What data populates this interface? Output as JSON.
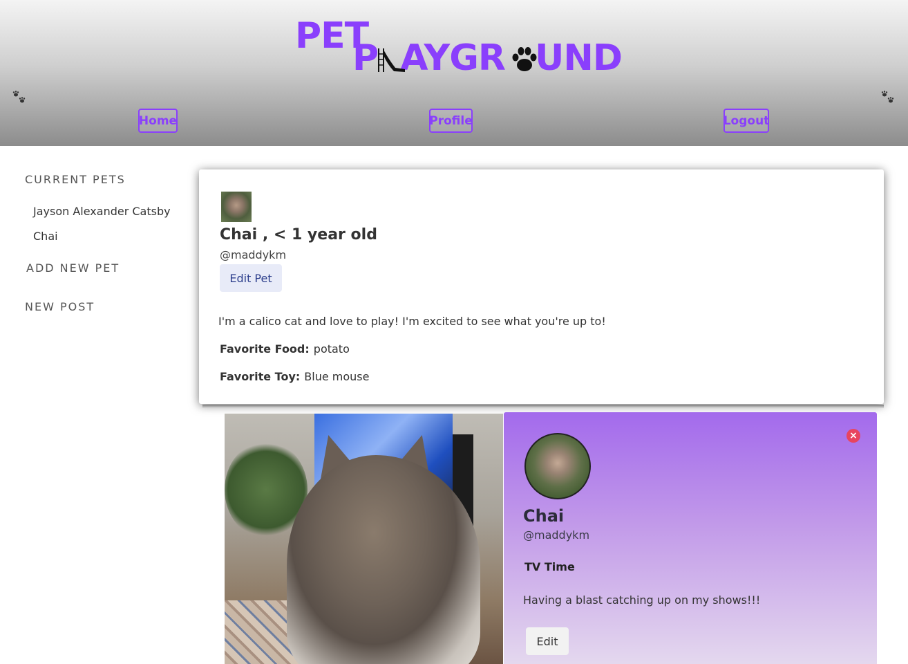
{
  "header": {
    "logo_pet": "PET",
    "logo_play_prefix": "P",
    "logo_play_mid": "AYGR",
    "logo_play_suffix": "UND",
    "brand_color": "#8a3ffc",
    "nav": {
      "home": "Home",
      "profile": "Profile",
      "logout": "Logout"
    }
  },
  "sidebar": {
    "current_pets_heading": "CURRENT PETS",
    "pets": [
      "Jayson Alexander Catsby",
      "Chai"
    ],
    "add_new_pet": "ADD NEW PET",
    "new_post": "NEW POST"
  },
  "profile": {
    "title": "Chai , < 1 year old",
    "handle": "@maddykm",
    "edit_button": "Edit Pet",
    "bio": "I'm a calico cat and love to play! I'm excited to see what you're up to!",
    "favorite_food_label": "Favorite Food:",
    "favorite_food": "potato",
    "favorite_toy_label": "Favorite Toy:",
    "favorite_toy": "Blue mouse"
  },
  "post": {
    "delete_icon": "×",
    "pet_name": "Chai",
    "handle": "@maddykm",
    "title": "TV Time",
    "body": "Having a blast catching up on my shows!!!",
    "edit_button": "Edit",
    "accent_color": "#a36aec"
  }
}
